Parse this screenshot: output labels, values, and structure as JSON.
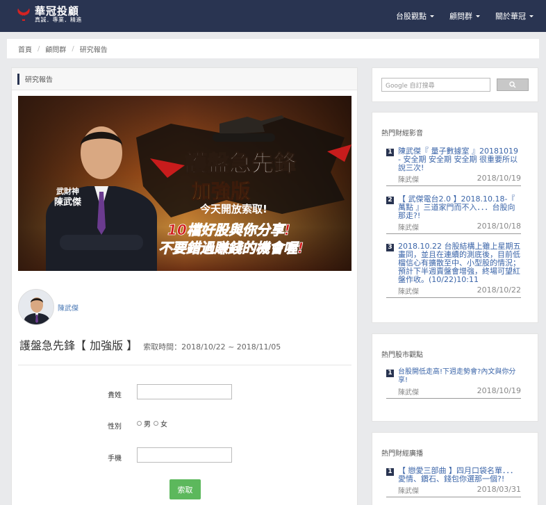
{
  "header": {
    "brand_name": "華冠投顧",
    "brand_slogan": "真誠．專業．精進",
    "nav": [
      {
        "label": "台股觀點"
      },
      {
        "label": "顧問群"
      },
      {
        "label": "關於華冠"
      }
    ]
  },
  "breadcrumb": [
    "首頁",
    "顧問群",
    "研究報告"
  ],
  "main": {
    "section_title": "研究報告",
    "banner": {
      "badge_line1": "武財神",
      "badge_line2": "陳武傑",
      "headline": "護盤急先鋒",
      "edition": "加強版",
      "offer": "今天開放索取!",
      "line1": "10檔好股與你分享!",
      "line2": "不要錯過賺錢的機會喔!"
    },
    "author": "陳武傑",
    "title": "護盤急先鋒【 加強版 】",
    "period": "索取時間：2018/10/22 ~ 2018/11/05",
    "form": {
      "name_label": "貴姓",
      "gender_label": "性別",
      "gender_options": [
        "男",
        "女"
      ],
      "phone_label": "手機",
      "submit_label": "索取"
    }
  },
  "sidebar": {
    "search_placeholder": "Google 自訂搜尋",
    "videos": {
      "title": "熱門財經影音",
      "items": [
        {
          "num": "1",
          "title": "陳武傑『 量子數據室 』20181019 - 安全期 安全期 安全期 很重要所以說三次!",
          "author": "陳武傑",
          "date": "2018/10/19"
        },
        {
          "num": "2",
          "title": "【 武傑電台2.0 】2018.10.18-『 萬點 』三道家門而不入．．．台股向那走?!",
          "author": "陳武傑",
          "date": "2018/10/18"
        },
        {
          "num": "3",
          "title": "2018.10.22 台股結構上雖上星期五畫同，並且在連續的測底後，目前低檔信心有擴散至中、小型股的情況；預計下半週賣盤會增強，終場可望紅盤作收。(10/22)10:11",
          "author": "陳武傑",
          "date": "2018/10/22"
        }
      ]
    },
    "views": {
      "title": "熱門股市觀點",
      "items": [
        {
          "num": "1",
          "title": "台股開低走高!下週走勢會?內文與你分享!",
          "author": "陳武傑",
          "date": "2018/10/19"
        }
      ]
    },
    "broadcast": {
      "title": "熱門財經廣播",
      "items": [
        {
          "num": "1",
          "title": "【 戀愛三部曲 】四月口袋名單．．．愛情、鑽石、錢包你選那一個?!",
          "author": "陳武傑",
          "date": "2018/03/31"
        }
      ]
    }
  }
}
